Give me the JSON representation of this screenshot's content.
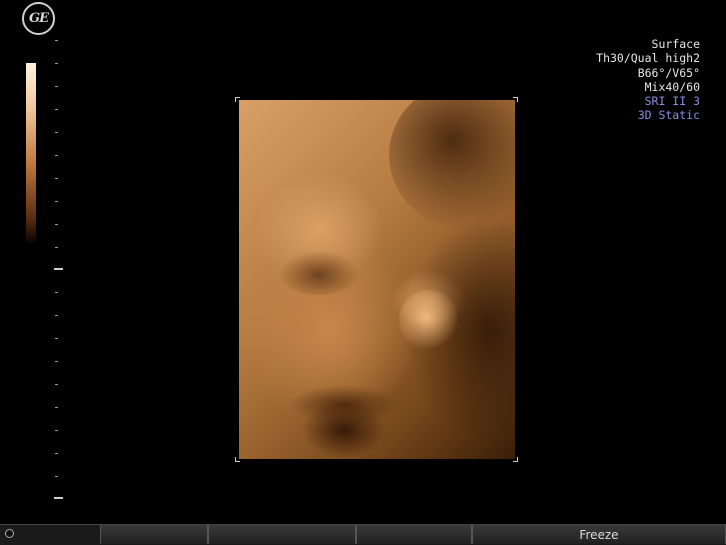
{
  "logo": {
    "text": "GE"
  },
  "params": {
    "mode": "Surface",
    "threshold_quality": "Th30/Qual high2",
    "angles": "B66°/V65°",
    "mix": "Mix40/60",
    "sri": "SRI II 3",
    "render_mode": "3D Static"
  },
  "colors": {
    "param_text": "#e6e6e6",
    "param_highlight": "#8c8ce0",
    "render_tint": "#c68a52",
    "background": "#000000"
  },
  "softkeys": {
    "freeze_label": "Freeze"
  },
  "icons": {
    "logo": "ge-logo-icon",
    "indicator": "status-dot-icon"
  }
}
